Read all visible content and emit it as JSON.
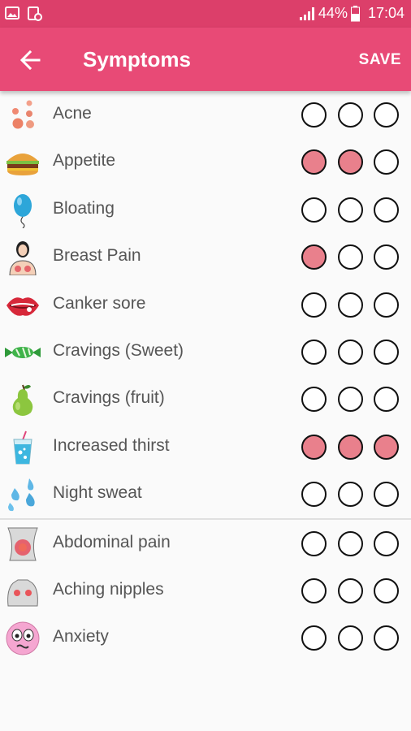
{
  "status_bar": {
    "battery": "44%",
    "time": "17:04"
  },
  "toolbar": {
    "title": "Symptoms",
    "save_label": "SAVE"
  },
  "colors": {
    "status_bar": "#dc3f6a",
    "toolbar": "#e84a76",
    "selected_circle": "#e9808c"
  },
  "symptoms_group1": [
    {
      "label": "Acne",
      "icon": "acne-icon",
      "levels": [
        false,
        false,
        false
      ]
    },
    {
      "label": "Appetite",
      "icon": "burger-icon",
      "levels": [
        true,
        true,
        false
      ]
    },
    {
      "label": "Bloating",
      "icon": "balloon-icon",
      "levels": [
        false,
        false,
        false
      ]
    },
    {
      "label": "Breast Pain",
      "icon": "breast-pain-icon",
      "levels": [
        true,
        false,
        false
      ]
    },
    {
      "label": "Canker sore",
      "icon": "lips-icon",
      "levels": [
        false,
        false,
        false
      ]
    },
    {
      "label": "Cravings (Sweet)",
      "icon": "candy-icon",
      "levels": [
        false,
        false,
        false
      ]
    },
    {
      "label": "Cravings (fruit)",
      "icon": "pear-icon",
      "levels": [
        false,
        false,
        false
      ]
    },
    {
      "label": "Increased thirst",
      "icon": "drink-icon",
      "levels": [
        true,
        true,
        true
      ]
    },
    {
      "label": "Night sweat",
      "icon": "sweat-drops-icon",
      "levels": [
        false,
        false,
        false
      ]
    }
  ],
  "symptoms_group2": [
    {
      "label": "Abdominal pain",
      "icon": "abdomen-icon",
      "levels": [
        false,
        false,
        false
      ]
    },
    {
      "label": "Aching nipples",
      "icon": "torso-icon",
      "levels": [
        false,
        false,
        false
      ]
    },
    {
      "label": "Anxiety",
      "icon": "anxious-face-icon",
      "levels": [
        false,
        false,
        false
      ]
    }
  ]
}
